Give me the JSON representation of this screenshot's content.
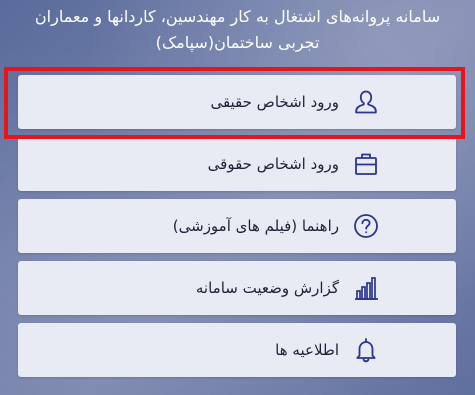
{
  "header": {
    "title_line1": "سامانه پروانه‌های اشتغال به کار مهندسین، کاردانها و معماران",
    "title_line2": "تجربی ساختمان(سپامک)"
  },
  "menu": {
    "items": [
      {
        "label": "ورود اشخاص حقیقی",
        "icon": "person-icon"
      },
      {
        "label": "ورود اشخاص حقوقی",
        "icon": "briefcase-icon"
      },
      {
        "label": "راهنما (فیلم های آموزشی)",
        "icon": "help-circle-icon"
      },
      {
        "label": "گزارش وضعیت سامانه",
        "icon": "bar-chart-icon"
      },
      {
        "label": "اطلاعیه ها",
        "icon": "bell-icon"
      }
    ]
  },
  "colors": {
    "icon": "#2b3490",
    "highlight": "#e8141c",
    "item_bg": "#e9ebf4"
  }
}
